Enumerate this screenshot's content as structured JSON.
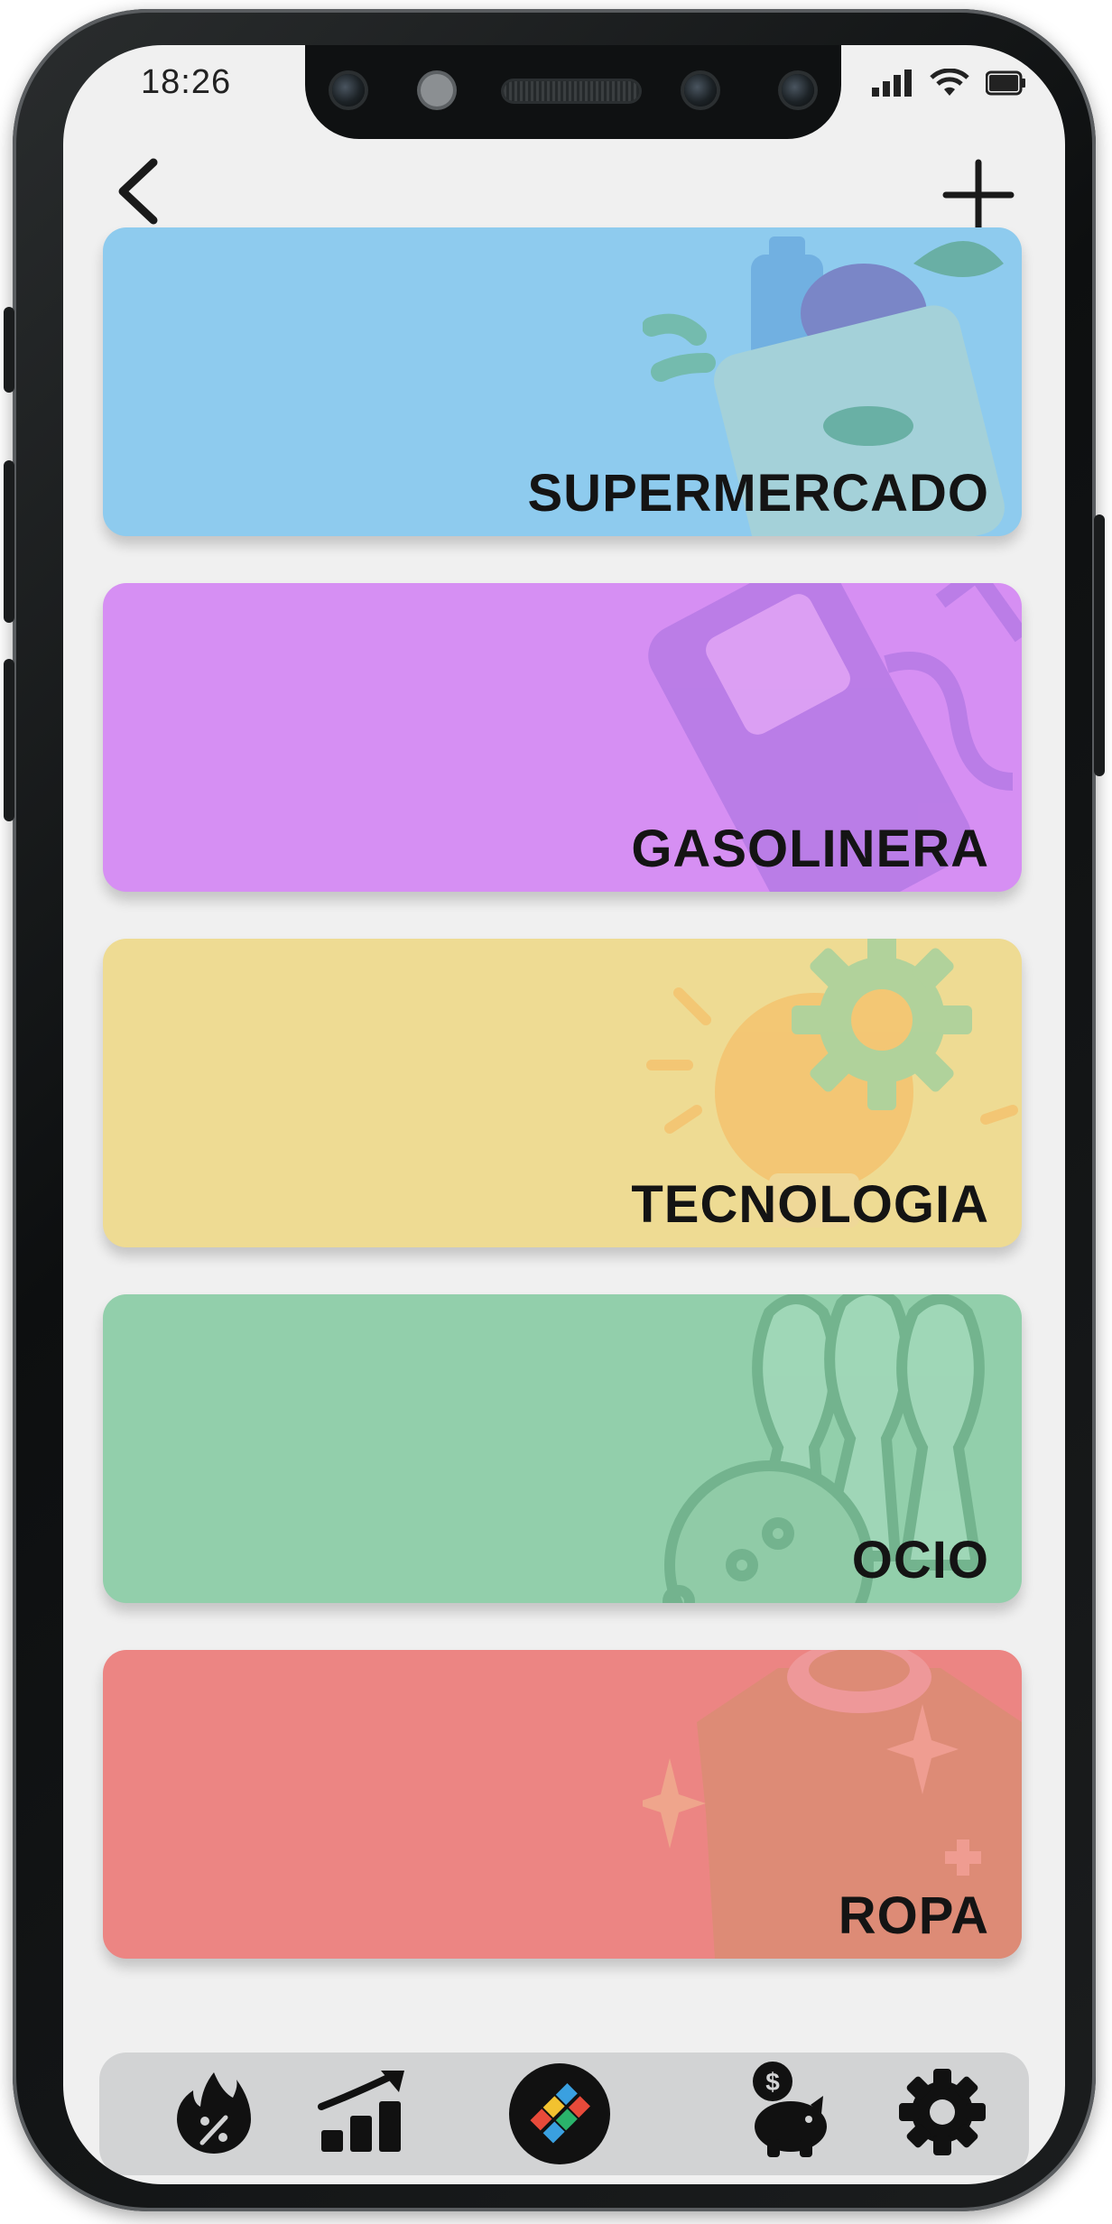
{
  "status_bar": {
    "time": "18:26"
  },
  "categories": [
    {
      "label": "SUPERMERCADO",
      "color": "#8ecbee",
      "icon": "grocery-bag-icon"
    },
    {
      "label": "GASOLINERA",
      "color": "#d68ff3",
      "icon": "gas-pump-icon"
    },
    {
      "label": "TECNOLOGIA",
      "color": "#eedb93",
      "icon": "lightbulb-gear-icon"
    },
    {
      "label": "OCIO",
      "color": "#92cfab",
      "icon": "bowling-icon"
    },
    {
      "label": "ROPA",
      "color": "#ec8583",
      "icon": "shirt-icon"
    }
  ],
  "bottom_nav": [
    {
      "icon": "discount-flame-icon"
    },
    {
      "icon": "growth-chart-icon"
    },
    {
      "icon": "app-logo-icon"
    },
    {
      "icon": "piggy-bank-icon"
    },
    {
      "icon": "gear-icon"
    }
  ]
}
